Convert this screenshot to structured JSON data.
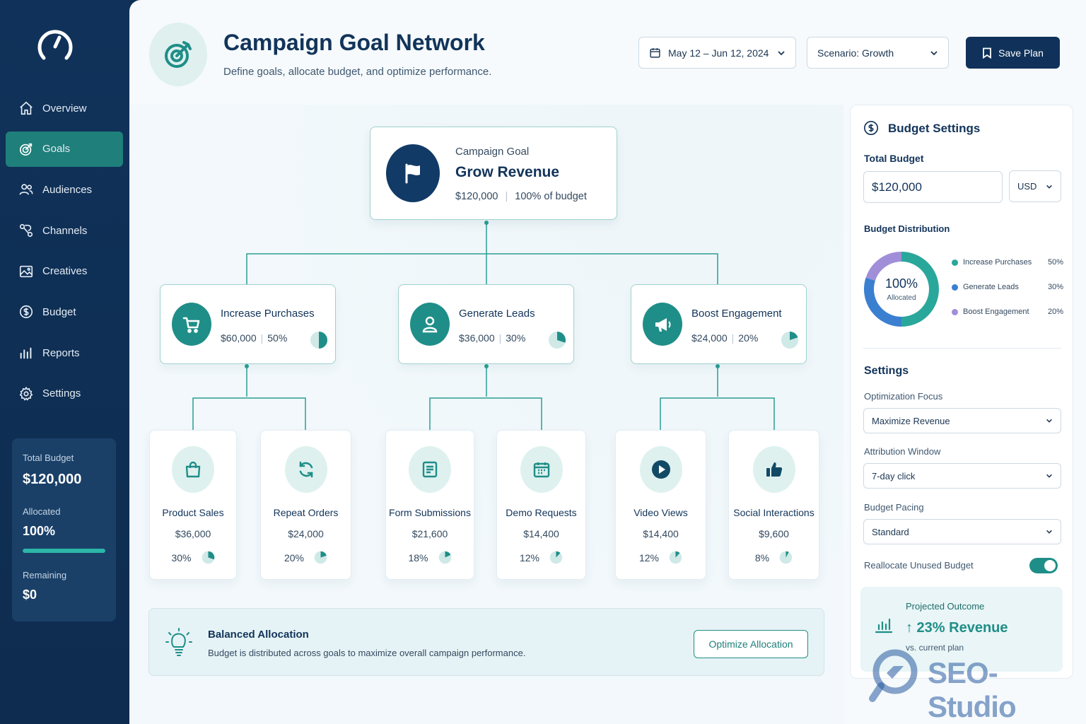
{
  "sidebar": {
    "items": [
      {
        "label": "Overview",
        "icon": "home-icon"
      },
      {
        "label": "Goals",
        "icon": "target-icon",
        "active": true
      },
      {
        "label": "Audiences",
        "icon": "users-icon"
      },
      {
        "label": "Channels",
        "icon": "channels-icon"
      },
      {
        "label": "Creatives",
        "icon": "image-icon"
      },
      {
        "label": "Budget",
        "icon": "dollar-icon"
      },
      {
        "label": "Reports",
        "icon": "bar-chart-icon"
      },
      {
        "label": "Settings",
        "icon": "gear-icon"
      }
    ],
    "budget_card": {
      "total_label": "Total Budget",
      "total_value": "$120,000",
      "allocated_label": "Allocated",
      "allocated_value": "100%",
      "allocated_fraction": 1.0,
      "remaining_label": "Remaining",
      "remaining_value": "$0"
    }
  },
  "header": {
    "title": "Campaign Goal Network",
    "subtitle": "Define goals, allocate budget, and optimize performance.",
    "date_range": "May 12 – Jun 12, 2024",
    "scenario": "Scenario: Growth",
    "save_label": "Save Plan"
  },
  "goal": {
    "kicker": "Campaign Goal",
    "name": "Grow Revenue",
    "amount": "$120,000",
    "share": "100% of budget"
  },
  "subgoals": [
    {
      "name": "Increase Purchases",
      "amount": "$60,000",
      "pct": "50%",
      "fraction": 0.5,
      "icon": "cart-icon"
    },
    {
      "name": "Generate Leads",
      "amount": "$36,000",
      "pct": "30%",
      "fraction": 0.3,
      "icon": "person-icon"
    },
    {
      "name": "Boost Engagement",
      "amount": "$24,000",
      "pct": "20%",
      "fraction": 0.2,
      "icon": "megaphone-icon"
    }
  ],
  "leaves": [
    {
      "name": "Product Sales",
      "amount": "$36,000",
      "pct": "30%",
      "fraction": 0.3,
      "icon": "bag-icon"
    },
    {
      "name": "Repeat Orders",
      "amount": "$24,000",
      "pct": "20%",
      "fraction": 0.2,
      "icon": "refresh-icon"
    },
    {
      "name": "Form Submissions",
      "amount": "$21,600",
      "pct": "18%",
      "fraction": 0.18,
      "icon": "form-icon"
    },
    {
      "name": "Demo Requests",
      "amount": "$14,400",
      "pct": "12%",
      "fraction": 0.12,
      "icon": "calendar-icon"
    },
    {
      "name": "Video Views",
      "amount": "$14,400",
      "pct": "12%",
      "fraction": 0.12,
      "icon": "play-icon"
    },
    {
      "name": "Social Interactions",
      "amount": "$9,600",
      "pct": "8%",
      "fraction": 0.08,
      "icon": "thumbs-up-icon"
    }
  ],
  "banner": {
    "title": "Balanced Allocation",
    "text": "Budget is distributed across goals to maximize overall campaign performance.",
    "button": "Optimize Allocation"
  },
  "budget_settings": {
    "title": "Budget Settings",
    "total_label": "Total Budget",
    "total_value": "$120,000",
    "currency": "USD",
    "distribution_label": "Budget Distribution",
    "donut_center": "100%",
    "donut_sub": "Allocated",
    "distribution": [
      {
        "name": "Increase Purchases",
        "pct": "50%",
        "value": 50,
        "color": "#2aa79b"
      },
      {
        "name": "Generate Leads",
        "pct": "30%",
        "value": 30,
        "color": "#3b7fd0"
      },
      {
        "name": "Boost Engagement",
        "pct": "20%",
        "value": 20,
        "color": "#a08fd8"
      }
    ],
    "settings_label": "Settings",
    "optimization_label": "Optimization Focus",
    "optimization_value": "Maximize Revenue",
    "attribution_label": "Attribution Window",
    "attribution_value": "7-day click",
    "pacing_label": "Budget Pacing",
    "pacing_value": "Standard",
    "reallocate_label": "Reallocate Unused Budget",
    "reallocate_on": true
  },
  "outcome": {
    "label": "Projected Outcome",
    "value": "↑ 23% Revenue",
    "sub": "vs. current plan"
  },
  "watermark": {
    "text": "SEO-Studio"
  },
  "colors": {
    "navy": "#10325a",
    "teal": "#1f8e88",
    "accent": "#2bb6a8"
  }
}
